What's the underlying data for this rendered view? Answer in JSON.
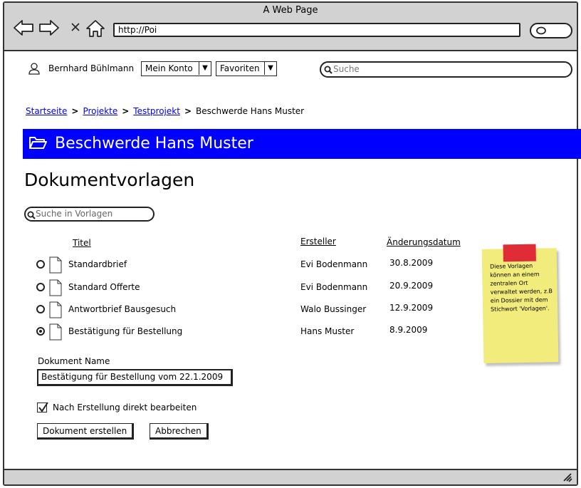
{
  "window": {
    "title": "A Web Page"
  },
  "browser": {
    "url": "http://Poi",
    "icons": [
      "back-arrow-icon",
      "forward-arrow-icon",
      "close-icon",
      "home-icon",
      "search-icon"
    ]
  },
  "header": {
    "user_name": "Bernhard Bühlmann",
    "menu_account": "Mein Konto",
    "menu_favorites": "Favoriten",
    "search_placeholder": "Suche"
  },
  "breadcrumb": {
    "items": [
      "Startseite",
      "Projekte",
      "Testprojekt"
    ],
    "current": "Beschwerde Hans Muster"
  },
  "banner": {
    "title": "Beschwerde Hans Muster",
    "color": "#0000ff"
  },
  "page": {
    "heading": "Dokumentvorlagen",
    "template_search_placeholder": "Suche in Vorlagen"
  },
  "table": {
    "columns": [
      "Titel",
      "Ersteller",
      "Änderungsdatum"
    ],
    "rows": [
      {
        "title": "Standardbrief",
        "author": "Evi Bodenmann",
        "date": "30.8.2009",
        "selected": false
      },
      {
        "title": "Standard Offerte",
        "author": "Evi Bodenmann",
        "date": "20.9.2009",
        "selected": false
      },
      {
        "title": "Antwortbrief Bausgesuch",
        "author": "Walo Bussinger",
        "date": "12.9.2009",
        "selected": false
      },
      {
        "title": "Bestätigung für Bestellung",
        "author": "Hans Muster",
        "date": "8.9.2009",
        "selected": true
      }
    ]
  },
  "sticky_note": {
    "text": "Diese Vorlagen können an einem zentralen Ort verwaltet werden, z.B ein Dossier mit dem Stichwort 'Vorlagen'.",
    "color": "#f2ec7d",
    "tape_color": "#e02c36"
  },
  "form": {
    "docname_label": "Dokument Name",
    "docname_value": "Bestätigung für Bestellung vom 22.1.2009",
    "edit_checkbox_label": "Nach Erstellung direkt bearbeiten",
    "edit_checked": true,
    "create_button": "Dokument erstellen",
    "cancel_button": "Abbrechen"
  }
}
